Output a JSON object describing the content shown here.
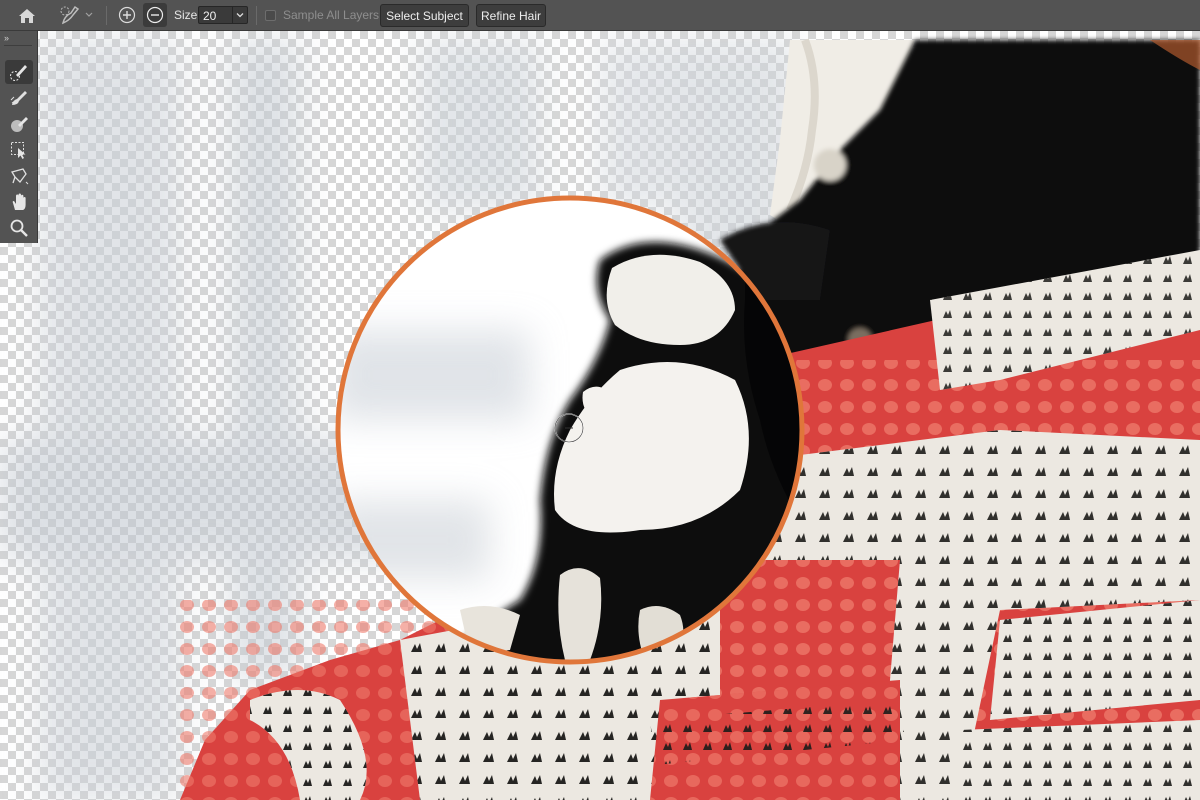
{
  "options_bar": {
    "size_label": "Size:",
    "size_value": "20",
    "sample_all_layers_label": "Sample All Layers",
    "sample_all_layers_checked": false,
    "select_subject_label": "Select Subject",
    "refine_hair_label": "Refine Hair",
    "mode": "subtract"
  },
  "tools": [
    {
      "icon": "quick-selection-brush-icon",
      "active": true
    },
    {
      "icon": "refine-edge-brush-icon",
      "active": false
    },
    {
      "icon": "brush-icon",
      "active": false
    },
    {
      "icon": "object-selection-icon",
      "active": false
    },
    {
      "icon": "lasso-icon",
      "active": false
    },
    {
      "icon": "hand-icon",
      "active": false
    },
    {
      "icon": "zoom-icon",
      "active": false
    }
  ],
  "colors": {
    "ui_panel": "#535353",
    "highlight_ring": "#e0763a",
    "dress_red": "#d9423f",
    "hair_black": "#0c0c0e"
  }
}
